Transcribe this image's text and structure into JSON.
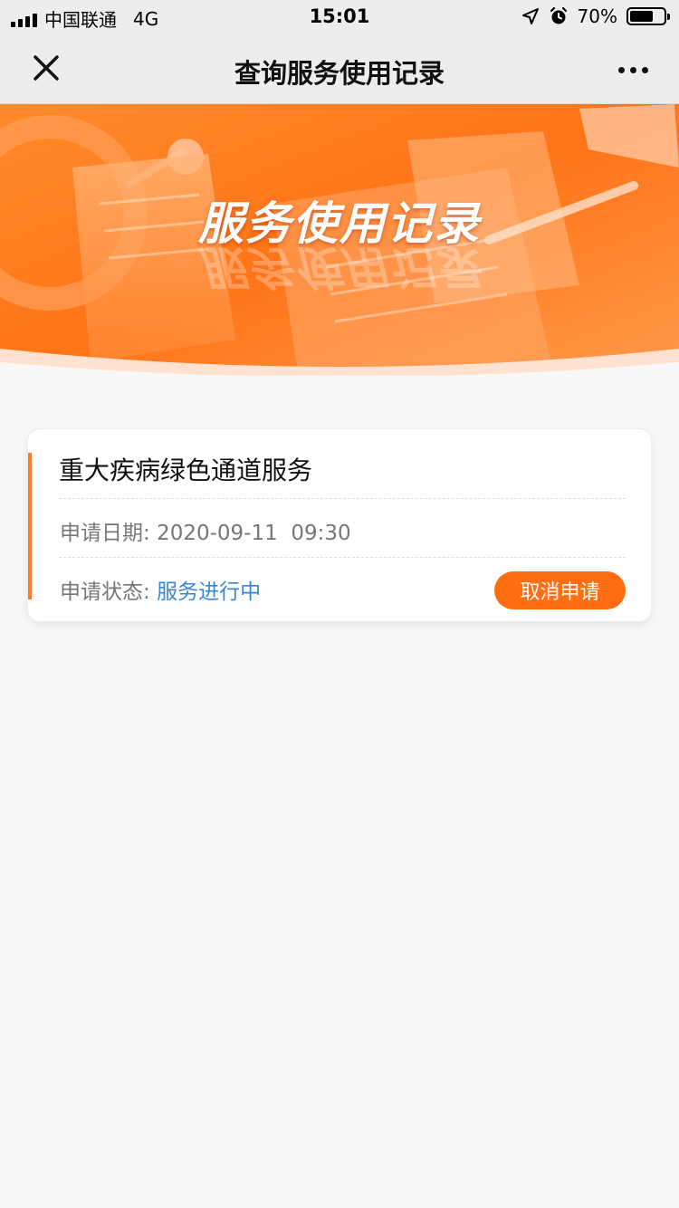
{
  "status_bar": {
    "carrier": "中国联通",
    "network": "4G",
    "time": "15:01",
    "battery": "70%",
    "battery_level": 0.7
  },
  "nav": {
    "title": "查询服务使用记录",
    "close_icon": "close-icon",
    "more_icon": "more-icon"
  },
  "banner": {
    "title": "服务使用记录",
    "colors": {
      "primary": "#ff7a1a",
      "light": "#ffb27a"
    }
  },
  "records": [
    {
      "title": "重大疾病绿色通道服务",
      "date_label": "申请日期:",
      "date_value": "2020-09-11  09:30",
      "status_label": "申请状态:",
      "status_value": "服务进行中",
      "cancel_label": "取消申请"
    }
  ],
  "colors": {
    "accent": "#ff6e12",
    "status_blue": "#3a86d6",
    "background": "#f8f8f8"
  }
}
